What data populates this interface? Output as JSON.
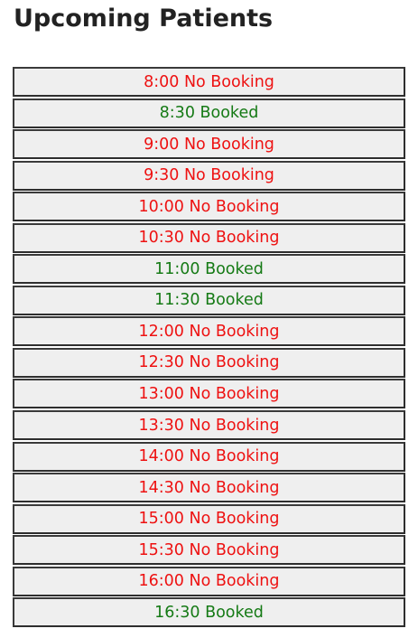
{
  "page": {
    "title": "Upcoming Patients"
  },
  "colors": {
    "no_booking": "#ee1111",
    "booked": "#157a15",
    "slot_background": "#efefef",
    "slot_border": "#3a3a3a"
  },
  "slots": [
    {
      "label": "8:00 No Booking",
      "status": "free"
    },
    {
      "label": "8:30 Booked",
      "status": "booked"
    },
    {
      "label": "9:00 No Booking",
      "status": "free"
    },
    {
      "label": "9:30 No Booking",
      "status": "free"
    },
    {
      "label": "10:00 No Booking",
      "status": "free"
    },
    {
      "label": "10:30 No Booking",
      "status": "free"
    },
    {
      "label": "11:00 Booked",
      "status": "booked"
    },
    {
      "label": "11:30 Booked",
      "status": "booked"
    },
    {
      "label": "12:00 No Booking",
      "status": "free"
    },
    {
      "label": "12:30 No Booking",
      "status": "free"
    },
    {
      "label": "13:00 No Booking",
      "status": "free"
    },
    {
      "label": "13:30 No Booking",
      "status": "free"
    },
    {
      "label": "14:00 No Booking",
      "status": "free"
    },
    {
      "label": "14:30 No Booking",
      "status": "free"
    },
    {
      "label": "15:00 No Booking",
      "status": "free"
    },
    {
      "label": "15:30 No Booking",
      "status": "free"
    },
    {
      "label": "16:00 No Booking",
      "status": "free"
    },
    {
      "label": "16:30 Booked",
      "status": "booked"
    }
  ]
}
